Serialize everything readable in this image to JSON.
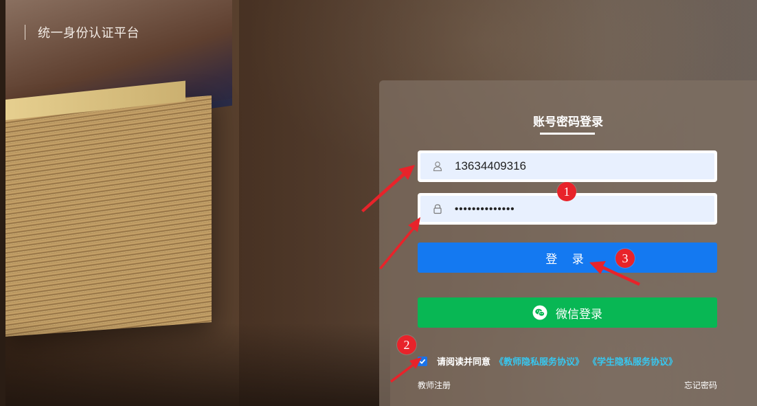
{
  "brand": {
    "title": "统一身份认证平台"
  },
  "login": {
    "title": "账号密码登录",
    "username_value": "13634409316",
    "password_value": "••••••••••••••",
    "login_button": "登 录",
    "wechat_button": "微信登录",
    "agree_text": "请阅读并同意",
    "teacher_policy": "《教师隐私服务协议》",
    "student_policy": "《学生隐私服务协议》",
    "register_link": "教师注册",
    "forgot_link": "忘记密码",
    "agreement_checked": true
  },
  "annotations": {
    "markers": [
      "1",
      "2",
      "3"
    ],
    "color": "#e8232a"
  },
  "colors": {
    "login_button": "#1479f1",
    "wechat_button": "#08b754",
    "link": "#37c7f0"
  }
}
